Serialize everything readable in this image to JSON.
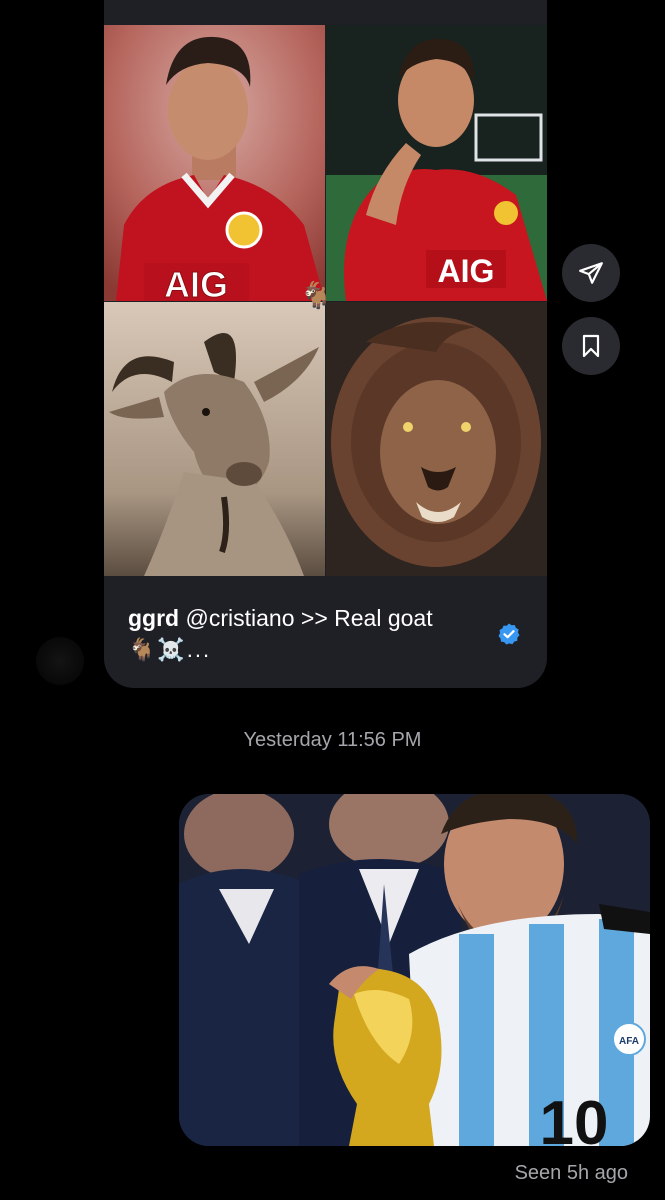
{
  "shared_post": {
    "username": "ggrd",
    "caption_text": "@cristiano >> Real goat",
    "caption_emoji": "🐐☠️...",
    "sticker_emoji": "🐐",
    "jersey_sponsor": "AIG",
    "verified": true
  },
  "actions": {
    "share_icon": "paper-plane-icon",
    "save_icon": "bookmark-icon"
  },
  "timestamp": "Yesterday 11:56 PM",
  "sent_image": {
    "jersey_number": "10",
    "badge_text": "AFA"
  },
  "status": "Seen 5h ago",
  "colors": {
    "background": "#000000",
    "card": "#1f2026",
    "muted_text": "#a4a6ab",
    "verified_blue": "#3897f0",
    "button_bg": "#2a2b30"
  }
}
